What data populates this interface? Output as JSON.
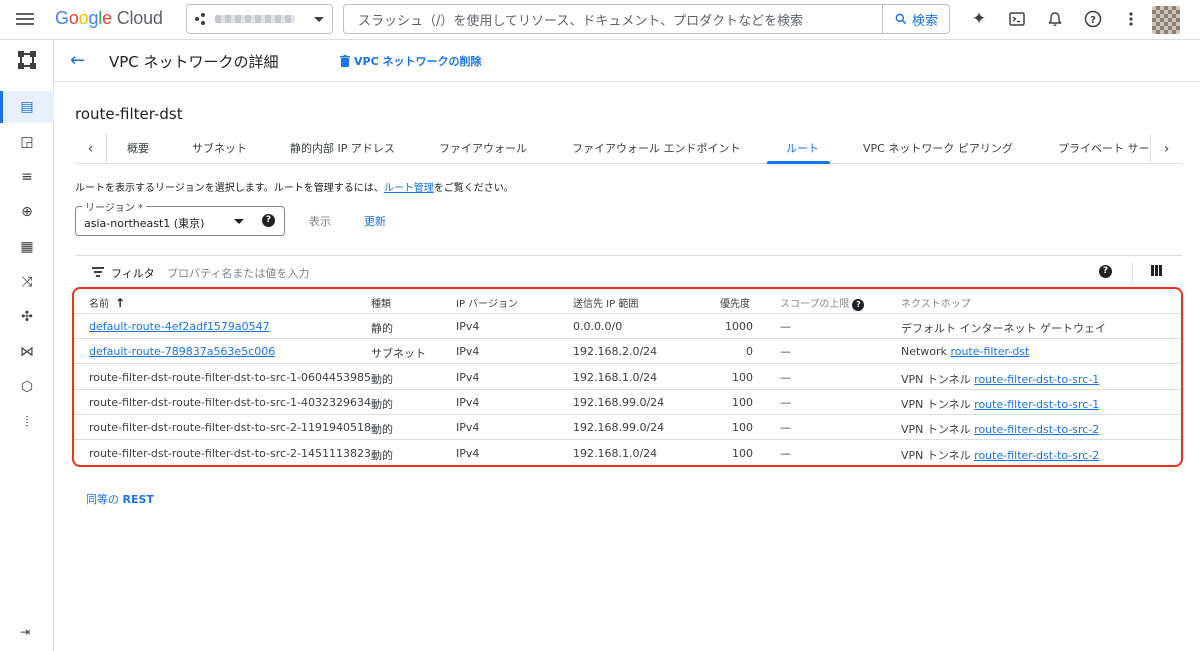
{
  "topbar": {
    "logo_text": "Google Cloud",
    "search_placeholder": "スラッシュ（/）を使用してリソース、ドキュメント、プロダクトなどを検索",
    "search_button": "検索"
  },
  "page_header": {
    "title": "VPC ネットワークの詳細",
    "delete_button": "VPC ネットワークの削除"
  },
  "network_name": "route-filter-dst",
  "tabs": [
    "概要",
    "サブネット",
    "静的内部 IP アドレス",
    "ファイアウォール",
    "ファイアウォール エンドポイント",
    "ルート",
    "VPC ネットワーク ピアリング",
    "プライベート サー"
  ],
  "active_tab": "ルート",
  "info": {
    "prefix": "ルートを表示するリージョンを選択します。ルートを管理するには、",
    "link": "ルート管理",
    "suffix": "をご覧ください。"
  },
  "region": {
    "label": "リージョン *",
    "value": "asia-northeast1 (東京)"
  },
  "actions": {
    "show": "表示",
    "refresh": "更新"
  },
  "filter": {
    "label": "フィルタ",
    "placeholder": "プロパティ名または値を入力"
  },
  "table": {
    "headers": {
      "name": "名前",
      "type": "種類",
      "ip_version": "IP バージョン",
      "dest_range": "送信先 IP 範囲",
      "priority": "優先度",
      "scope_limit": "スコープの上限",
      "next_hop": "ネクストホップ"
    },
    "rows": [
      {
        "name": "default-route-4ef2adf1579a0547",
        "type": "静的",
        "ip": "IPv4",
        "range": "0.0.0.0/0",
        "priority": "1000",
        "scope": "—",
        "hop_prefix": "デフォルト インターネット ゲートウェイ",
        "hop_link": ""
      },
      {
        "name": "default-route-789837a563e5c006",
        "type": "サブネット",
        "ip": "IPv4",
        "range": "192.168.2.0/24",
        "priority": "0",
        "scope": "—",
        "hop_prefix": "Network",
        "hop_link": "route-filter-dst"
      },
      {
        "name": "route-filter-dst-route-filter-dst-to-src-1-0604453985",
        "type": "動的",
        "ip": "IPv4",
        "range": "192.168.1.0/24",
        "priority": "100",
        "scope": "—",
        "hop_prefix": "VPN トンネル",
        "hop_link": "route-filter-dst-to-src-1"
      },
      {
        "name": "route-filter-dst-route-filter-dst-to-src-1-4032329634",
        "type": "動的",
        "ip": "IPv4",
        "range": "192.168.99.0/24",
        "priority": "100",
        "scope": "—",
        "hop_prefix": "VPN トンネル",
        "hop_link": "route-filter-dst-to-src-1"
      },
      {
        "name": "route-filter-dst-route-filter-dst-to-src-2-1191940518",
        "type": "動的",
        "ip": "IPv4",
        "range": "192.168.99.0/24",
        "priority": "100",
        "scope": "—",
        "hop_prefix": "VPN トンネル",
        "hop_link": "route-filter-dst-to-src-2"
      },
      {
        "name": "route-filter-dst-route-filter-dst-to-src-2-1451113823",
        "type": "動的",
        "ip": "IPv4",
        "range": "192.168.1.0/24",
        "priority": "100",
        "scope": "—",
        "hop_prefix": "VPN トンネル",
        "hop_link": "route-filter-dst-to-src-2"
      }
    ]
  },
  "rest_link": {
    "prefix": "同等の",
    "strong": "REST"
  },
  "colors": {
    "accent": "#1a73e8",
    "highlight_border": "#e8341f"
  }
}
